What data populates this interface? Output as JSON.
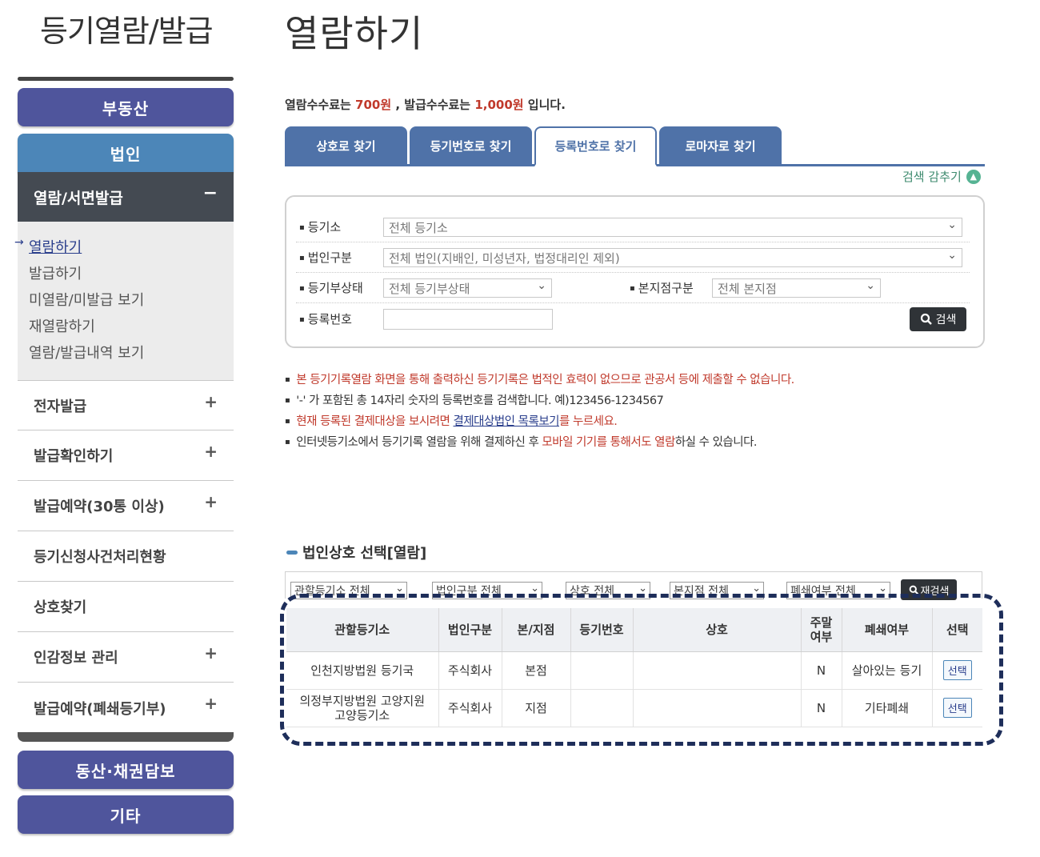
{
  "sidebar": {
    "title": "등기열람/발급",
    "btn_realestate": "부동산",
    "btn_corp": "법인",
    "section_head": "열람/서면발급",
    "section_toggle": "−",
    "sub_items": [
      "열람하기",
      "발급하기",
      "미열람/미발급 보기",
      "재열람하기",
      "열람/발급내역 보기"
    ],
    "menu": [
      {
        "label": "전자발급",
        "toggle": "+"
      },
      {
        "label": "발급확인하기",
        "toggle": "+"
      },
      {
        "label": "발급예약(30통 이상)",
        "toggle": "+"
      },
      {
        "label": "등기신청사건처리현황",
        "toggle": ""
      },
      {
        "label": "상호찾기",
        "toggle": ""
      },
      {
        "label": "인감정보 관리",
        "toggle": "+"
      },
      {
        "label": "발급예약(폐쇄등기부)",
        "toggle": "+"
      }
    ],
    "btn_movable": "동산·채권담보",
    "btn_etc": "기타"
  },
  "main": {
    "title": "열람하기",
    "fee": {
      "prefix": "열람수수료는 ",
      "view_fee": "700원",
      "mid": " , 발급수수료는 ",
      "issue_fee": "1,000원",
      "suffix": " 입니다."
    },
    "tabs": [
      "상호로 찾기",
      "등기번호로 찾기",
      "등록번호로 찾기",
      "로마자로 찾기"
    ],
    "hide_search": "검색 감추기",
    "form": {
      "registry_label": "등기소",
      "registry_value": "전체 등기소",
      "corp_type_label": "법인구분",
      "corp_type_value": "전체 법인(지배인, 미성년자, 법정대리인 제외)",
      "status_label": "등기부상태",
      "status_value": "전체 등기부상태",
      "branch_label": "본지점구분",
      "branch_value": "전체 본지점",
      "regno_label": "등록번호",
      "regno_value": "",
      "search_btn": "검색"
    },
    "notes": {
      "n1": "본 등기기록열람 화면을 통해 출력하신 등기기록은 법적인 효력이 없으므로 관공서 등에 제출할 수 없습니다.",
      "n2": "'-' 가 포함된 총 14자리 숫자의 등록번호를 검색합니다. 예)123456-1234567",
      "n3_a": "현재 등록된 결제대상을 보시려면 ",
      "n3_link": "결제대상법인 목록보기",
      "n3_b": "를 누르세요.",
      "n4_a": "인터넷등기소에서 등기기록 열람을 위해 결제하신 후 ",
      "n4_red": "모바일 기기를 통해서도 열람",
      "n4_b": "하실 수 있습니다."
    },
    "results": {
      "title": "법인상호 선택[열람]",
      "filters": [
        "관할등기소 전체",
        "법인구분 전체",
        "상호 전체",
        "본지점 전체",
        "폐쇄여부 전체"
      ],
      "reset_btn": "재검색",
      "headers": [
        "관할등기소",
        "법인구분",
        "본/지점",
        "등기번호",
        "상호",
        "주말\n여부",
        "폐쇄여부",
        "선택"
      ],
      "rows": [
        {
          "registry": "인천지방법원 등기국",
          "type": "주식회사",
          "branch": "본점",
          "regnum": "",
          "name": "",
          "weekend": "N",
          "closed": "살아있는 등기",
          "select": "선택"
        },
        {
          "registry": "의정부지방법원 고양지원\n고양등기소",
          "type": "주식회사",
          "branch": "지점",
          "regnum": "",
          "name": "",
          "weekend": "N",
          "closed": "기타폐쇄",
          "select": "선택"
        }
      ]
    }
  },
  "colors": {
    "tab_blue": "#4f72a8",
    "nav_purple": "#4f559c",
    "nav_blue": "#4c86b8",
    "alert_red": "#c0392b",
    "highlight": "#1e2e5a"
  }
}
